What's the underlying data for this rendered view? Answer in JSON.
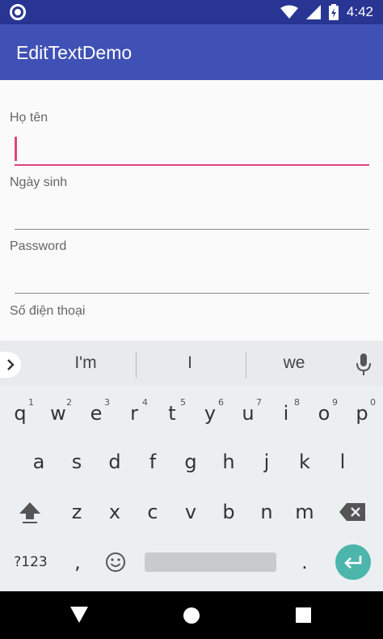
{
  "status": {
    "time": "4:42"
  },
  "app": {
    "title": "EditTextDemo"
  },
  "form": {
    "fields": [
      {
        "label": "Họ tên",
        "value": ""
      },
      {
        "label": "Ngày sinh",
        "value": ""
      },
      {
        "label": "Password",
        "value": ""
      },
      {
        "label": "Số điện thoại",
        "value": ""
      }
    ]
  },
  "keyboard": {
    "suggestions": [
      "I'm",
      "I",
      "we"
    ],
    "row1": [
      {
        "key": "q",
        "hint": "1"
      },
      {
        "key": "w",
        "hint": "2"
      },
      {
        "key": "e",
        "hint": "3"
      },
      {
        "key": "r",
        "hint": "4"
      },
      {
        "key": "t",
        "hint": "5"
      },
      {
        "key": "y",
        "hint": "6"
      },
      {
        "key": "u",
        "hint": "7"
      },
      {
        "key": "i",
        "hint": "8"
      },
      {
        "key": "o",
        "hint": "9"
      },
      {
        "key": "p",
        "hint": "0"
      }
    ],
    "row2": [
      "a",
      "s",
      "d",
      "f",
      "g",
      "h",
      "j",
      "k",
      "l"
    ],
    "row3": [
      "z",
      "x",
      "c",
      "v",
      "b",
      "n",
      "m"
    ],
    "symbols_label": "?123",
    "comma": ",",
    "period": "."
  },
  "colors": {
    "app_bar": "#3f51b5",
    "status_bar": "#283593",
    "accent": "#e0457b",
    "enter": "#4db6ac"
  }
}
